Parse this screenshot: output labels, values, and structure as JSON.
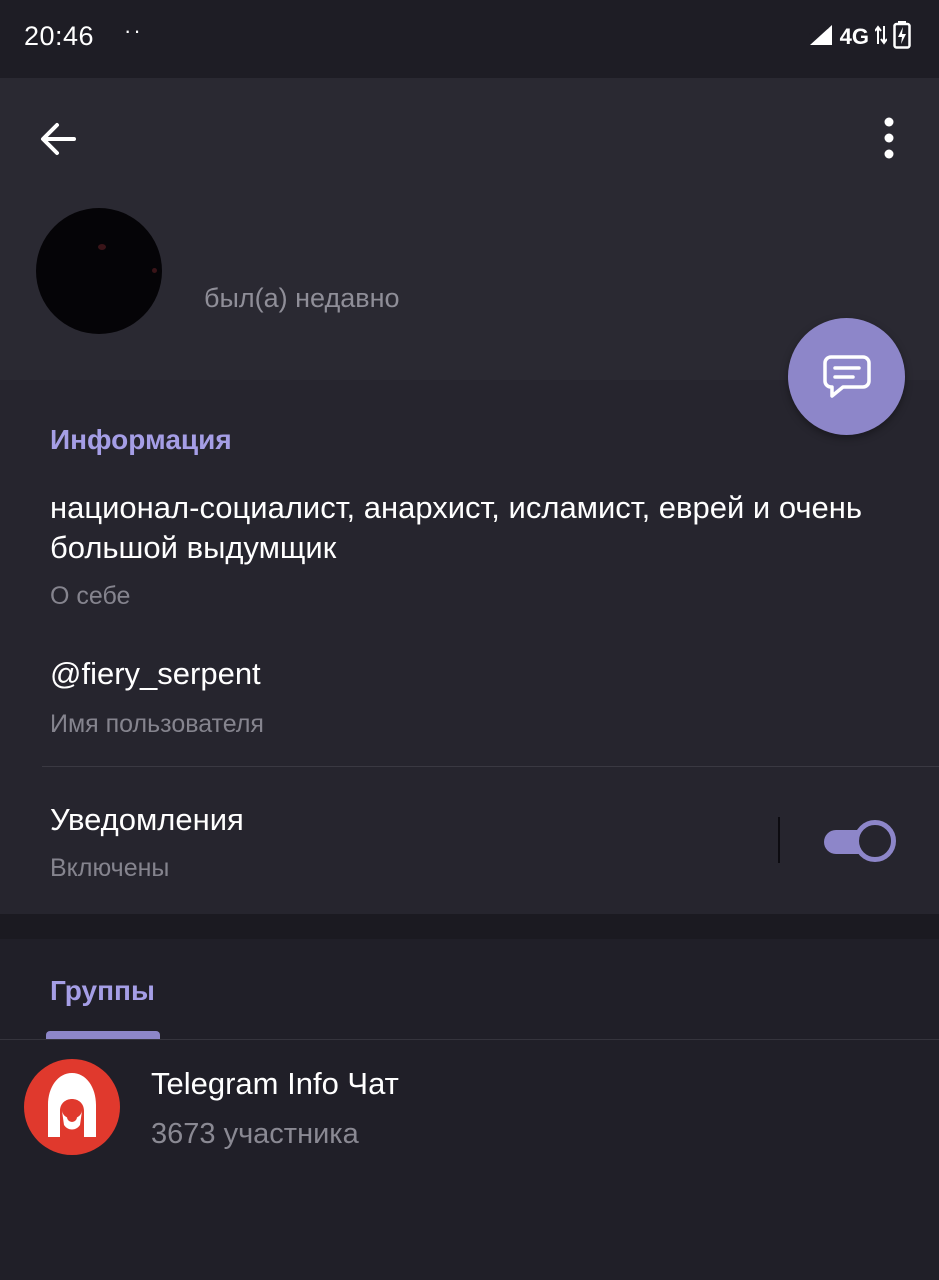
{
  "status_bar": {
    "time": "20:46",
    "indicator_dots": "··",
    "network": "4G"
  },
  "header": {
    "back_icon": "arrow-left-icon",
    "menu_icon": "more-vertical-icon",
    "last_seen": "был(а) недавно",
    "fab_icon": "message-icon"
  },
  "info": {
    "title": "Информация",
    "bio": "национал-социалист, анархист, исламист, еврей и очень большой выдумщик",
    "bio_caption": "О себе",
    "username": "@fiery_serpent",
    "username_caption": "Имя пользователя",
    "notifications_label": "Уведомления",
    "notifications_status": "Включены",
    "notifications_enabled": true
  },
  "groups": {
    "title": "Группы",
    "items": [
      {
        "name": "Telegram Info Чат",
        "members": "3673 участника",
        "avatar_color": "#e0392d"
      }
    ]
  },
  "colors": {
    "accent": "#8d86c9",
    "accent_text": "#a59ee6",
    "background": "#201f28",
    "header_bg": "#2a2932"
  }
}
